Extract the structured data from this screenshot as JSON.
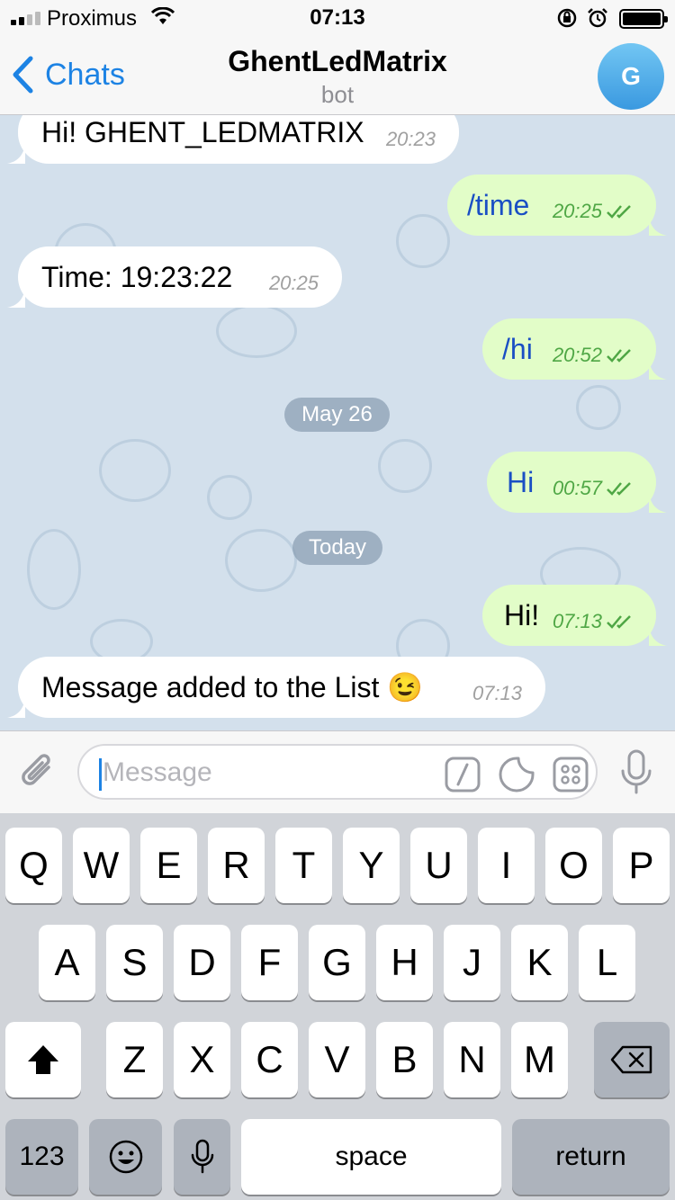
{
  "status_bar": {
    "carrier": "Proximus",
    "time": "07:13",
    "icons": [
      "signal-icon",
      "wifi-icon",
      "orientation-lock-icon",
      "alarm-icon",
      "battery-icon"
    ]
  },
  "nav": {
    "back_label": "Chats",
    "title": "GhentLedMatrix",
    "subtitle": "bot",
    "avatar_letter": "G"
  },
  "messages": [
    {
      "direction": "in",
      "text": "Hi! GHENT_LEDMATRIX",
      "time": "20:23"
    },
    {
      "direction": "out",
      "text": "/time",
      "time": "20:25"
    },
    {
      "direction": "in",
      "text": "Time: 19:23:22",
      "time": "20:25"
    },
    {
      "direction": "out",
      "text": "/hi",
      "time": "20:52"
    },
    {
      "direction": "out",
      "text": "Hi",
      "time": "00:57"
    },
    {
      "direction": "out",
      "text": "Hi!",
      "time": "07:13"
    },
    {
      "direction": "in",
      "text": "Message added to the List 😉",
      "time": "07:13"
    }
  ],
  "date_separators": [
    "May 26",
    "Today"
  ],
  "input": {
    "placeholder": "Message",
    "value": ""
  },
  "keyboard": {
    "row1": [
      "Q",
      "W",
      "E",
      "R",
      "T",
      "Y",
      "U",
      "I",
      "O",
      "P"
    ],
    "row2": [
      "A",
      "S",
      "D",
      "F",
      "G",
      "H",
      "J",
      "K",
      "L"
    ],
    "row3": [
      "Z",
      "X",
      "C",
      "V",
      "B",
      "N",
      "M"
    ],
    "numbers_label": "123",
    "space_label": "space",
    "return_label": "return"
  },
  "colors": {
    "accent": "#1d83e4",
    "chat_background": "#d3e0ec",
    "outgoing_bubble": "#e2fdc8",
    "incoming_bubble": "#ffffff",
    "read_check": "#4fa745"
  }
}
